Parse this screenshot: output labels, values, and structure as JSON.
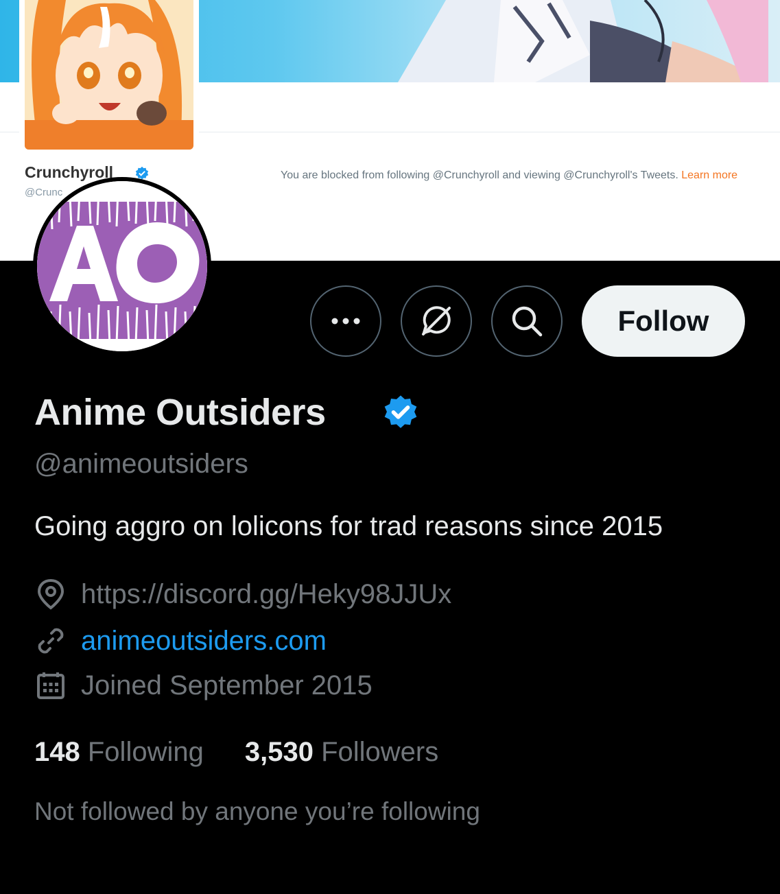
{
  "banner": {
    "account_name": "Crunchyroll",
    "account_handle": "@Crunc",
    "blocked_message": "You are blocked from following @Crunchyroll and viewing @Crunchyroll's Tweets. ",
    "learn_more": "Learn more"
  },
  "profile": {
    "avatar_text": "AO",
    "display_name": "Anime Outsiders",
    "handle": "@animeoutsiders",
    "bio": "Going aggro on lolicons for trad reasons since 2015",
    "location": "https://discord.gg/Heky98JJUx",
    "website": "animeoutsiders.com",
    "joined": "Joined September 2015",
    "following_count": "148",
    "following_label": "Following",
    "followers_count": "3,530",
    "followers_label": "Followers",
    "not_followed": "Not followed by anyone you’re following"
  },
  "actions": {
    "more_icon": "more-icon",
    "notifications_icon": "notifications-off-icon",
    "search_icon": "search-icon",
    "follow_label": "Follow"
  },
  "colors": {
    "background": "#000000",
    "accent": "#1d9bf0",
    "verified": "#1d9bf0",
    "crunchyroll_orange": "#f47521",
    "avatar_purple": "#9c5fb5"
  }
}
